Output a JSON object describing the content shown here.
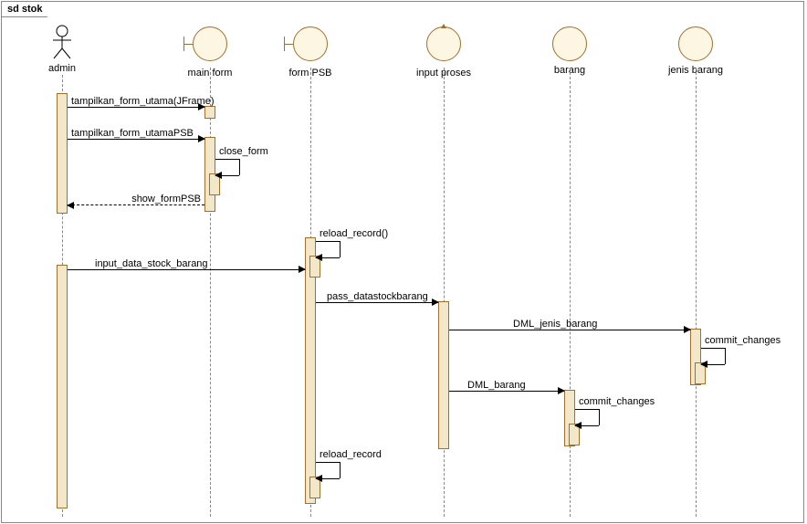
{
  "frame_title": "sd stok",
  "lifelines": {
    "admin": "admin",
    "mainform": "main form",
    "formpsb": "form PSB",
    "inputproses": "input proses",
    "barang": "barang",
    "jenisbarang": "jenis barang"
  },
  "messages": {
    "m1": "tampilkan_form_utama(JFrame)",
    "m2": "tampilkan_form_utamaPSB",
    "m3": "close_form",
    "m4": "show_formPSB",
    "m5": "reload_record()",
    "m6": "input_data_stock_barang",
    "m7": "pass_datastockbarang",
    "m8": "DML_jenis_barang",
    "m9": "commit_changes",
    "m10": "DML_barang",
    "m11": "commit_changes",
    "m12": "reload_record"
  },
  "chart_data": {
    "type": "sequence-diagram",
    "frame": "sd stok",
    "lifelines": [
      "admin",
      "main form",
      "form PSB",
      "input proses",
      "barang",
      "jenis barang"
    ],
    "lifeline_kinds": {
      "admin": "actor",
      "main form": "boundary",
      "form PSB": "boundary",
      "input proses": "control",
      "barang": "entity",
      "jenis barang": "entity"
    },
    "messages": [
      {
        "from": "admin",
        "to": "main form",
        "label": "tampilkan_form_utama(JFrame)",
        "type": "sync"
      },
      {
        "from": "admin",
        "to": "main form",
        "label": "tampilkan_form_utamaPSB",
        "type": "sync"
      },
      {
        "from": "main form",
        "to": "main form",
        "label": "close_form",
        "type": "self"
      },
      {
        "from": "main form",
        "to": "admin",
        "label": "show_formPSB",
        "type": "return"
      },
      {
        "from": "form PSB",
        "to": "form PSB",
        "label": "reload_record()",
        "type": "self"
      },
      {
        "from": "admin",
        "to": "form PSB",
        "label": "input_data_stock_barang",
        "type": "sync"
      },
      {
        "from": "form PSB",
        "to": "input proses",
        "label": "pass_datastockbarang",
        "type": "sync"
      },
      {
        "from": "input proses",
        "to": "jenis barang",
        "label": "DML_jenis_barang",
        "type": "sync"
      },
      {
        "from": "jenis barang",
        "to": "jenis barang",
        "label": "commit_changes",
        "type": "self"
      },
      {
        "from": "input proses",
        "to": "barang",
        "label": "DML_barang",
        "type": "sync"
      },
      {
        "from": "barang",
        "to": "barang",
        "label": "commit_changes",
        "type": "self"
      },
      {
        "from": "form PSB",
        "to": "form PSB",
        "label": "reload_record",
        "type": "self"
      }
    ]
  }
}
